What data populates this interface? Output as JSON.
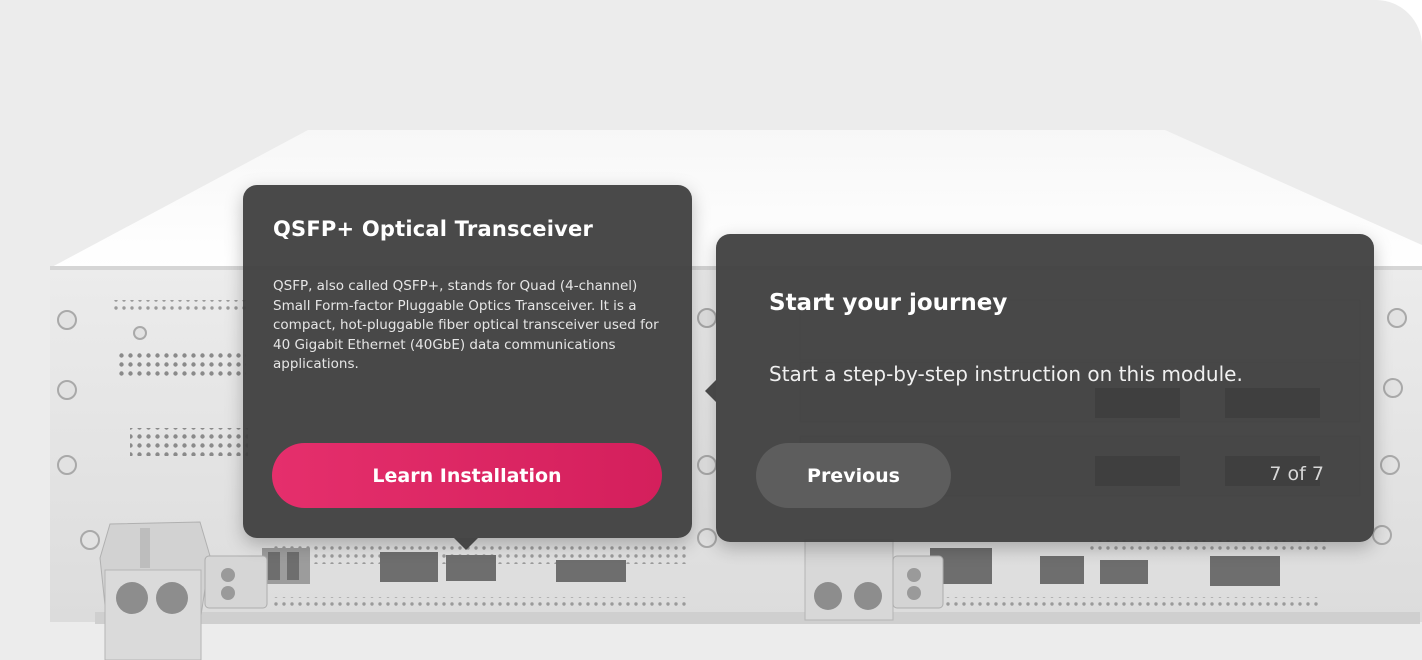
{
  "info_card": {
    "title": "QSFP+ Optical Transceiver",
    "description": "QSFP, also called QSFP+, stands for Quad (4-channel) Small Form-factor Pluggable Optics Transceiver. It is a compact, hot-pluggable fiber optical transceiver used for 40 Gigabit Ethernet (40GbE) data communications applications.",
    "button_label": "Learn Installation",
    "button_color": "#e52f6c"
  },
  "tour_card": {
    "title": "Start your journey",
    "body": "Start a step-by-step instruction on this module.",
    "previous_label": "Previous",
    "step_counter": "7 of 7"
  },
  "colors": {
    "background": "#ececec",
    "card": "#3e3e3e",
    "device_body": "#e9e9e9"
  }
}
